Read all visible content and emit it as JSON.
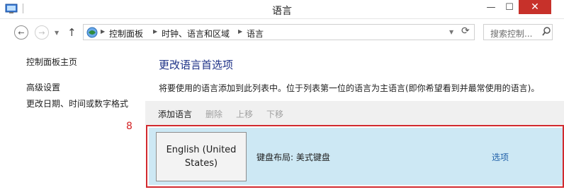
{
  "window": {
    "title": "语言",
    "minimize_glyph": "—",
    "maximize_glyph": "☐",
    "close_glyph": "✕"
  },
  "nav": {
    "back_glyph": "←",
    "forward_glyph": "→",
    "up_glyph": "↑",
    "breadcrumbs": [
      "控制面板",
      "时钟、语言和区域",
      "语言"
    ],
    "search_placeholder": "搜索控制..."
  },
  "sidebar": {
    "items": [
      {
        "label": "控制面板主页"
      },
      {
        "label": "高级设置"
      },
      {
        "label": "更改日期、时间或数字格式"
      }
    ]
  },
  "main": {
    "heading": "更改语言首选项",
    "description": "将要使用的语言添加到此列表中。位于列表第一位的语言为主语言(即你希望看到并最常使用的语言)。",
    "toolbar": {
      "add": "添加语言",
      "remove": "删除",
      "up": "上移",
      "down": "下移"
    },
    "annotation": "8",
    "language": {
      "name": "English (United States)",
      "keyboard": "键盘布局: 美式键盘",
      "options": "选项"
    }
  },
  "colors": {
    "accent_heading": "#1e3287",
    "selection": "#cde8f4",
    "highlight_box": "#d12a2f",
    "close_button": "#c7312a"
  }
}
